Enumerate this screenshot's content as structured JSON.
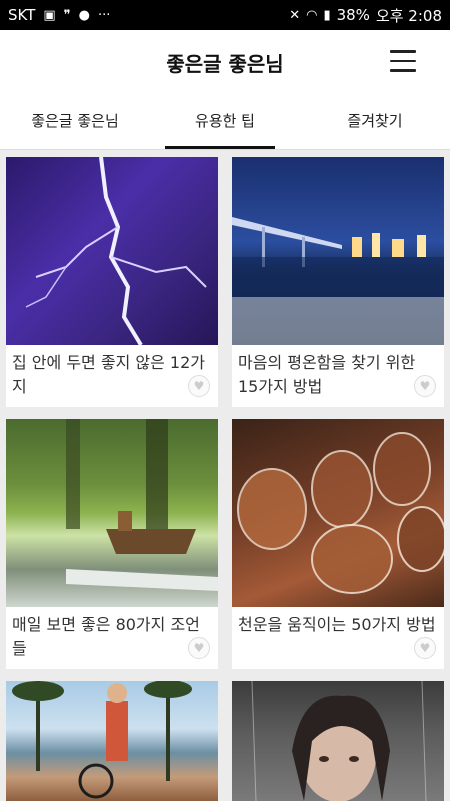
{
  "status_bar": {
    "carrier": "SKT",
    "battery": "38%",
    "time": "오후 2:08"
  },
  "header": {
    "title": "좋은글 좋은님"
  },
  "tabs": [
    {
      "label": "좋은글 좋은님"
    },
    {
      "label": "유용한 팁"
    },
    {
      "label": "즐겨찾기"
    }
  ],
  "cards": [
    {
      "title": "집 안에 두면 좋지 않은 12가지"
    },
    {
      "title": "마음의 평온함을 찾기 위한 15가지 방법"
    },
    {
      "title": "매일 보면 좋은 80가지 조언들"
    },
    {
      "title": "천운을 움직이는 50가지 방법"
    },
    {
      "title": ""
    },
    {
      "title": ""
    }
  ]
}
